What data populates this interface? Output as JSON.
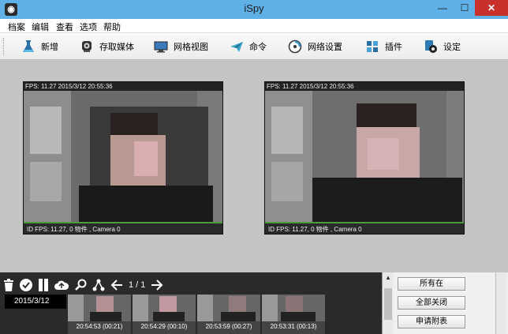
{
  "window": {
    "title": "iSpy",
    "app_icon": "camera-lens-icon",
    "min": "—",
    "max": "☐",
    "close": "✕"
  },
  "menu": [
    "档案",
    "编辑",
    "查看",
    "选项",
    "帮助"
  ],
  "toolbar": [
    {
      "label": "新增",
      "icon": "flask-icon"
    },
    {
      "label": "存取媒体",
      "icon": "webcam-icon"
    },
    {
      "label": "网格视图",
      "icon": "monitor-icon"
    },
    {
      "label": "命令",
      "icon": "paper-plane-icon"
    },
    {
      "label": "网络设置",
      "icon": "network-dial-icon"
    },
    {
      "label": "插件",
      "icon": "plugin-icon"
    },
    {
      "label": "设定",
      "icon": "settings-icon"
    }
  ],
  "cameras": [
    {
      "header": "FPS: 11.27 2015/3/12 20:55:36",
      "footer": "ID FPS: 11.27, 0 物件 , Camera 0"
    },
    {
      "header": "FPS: 11.27 2015/3/12 20:55:36",
      "footer": "ID FPS: 11.27, 0 物件 , Camera 0"
    }
  ],
  "media_bar": {
    "tools": [
      "trash-icon",
      "check-icon",
      "book-icon",
      "cloud-upload-icon",
      "search-icon",
      "share-tree-icon",
      "arrow-left-icon",
      "arrow-right-icon"
    ],
    "page": "1 / 1",
    "date": "2015/3/12",
    "thumbs": [
      "20:54:53 (00:21)",
      "20:54:29 (00:10)",
      "20:53:59 (00:27)",
      "20:53:31 (00:13)"
    ]
  },
  "right_buttons": [
    "所有在",
    "全部关闭",
    "申请附表"
  ]
}
